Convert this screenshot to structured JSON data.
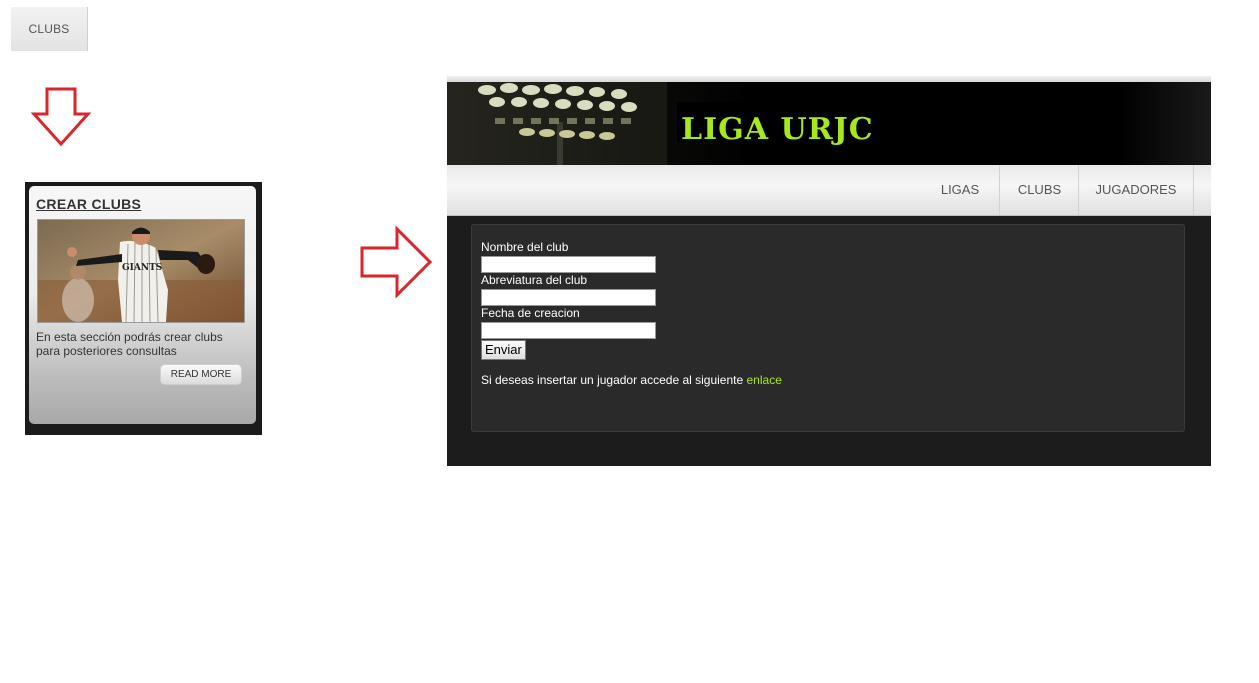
{
  "top_tab": {
    "label": "CLUBS"
  },
  "card": {
    "title": "CREAR CLUBS",
    "description": "En esta sección podrás crear clubs para posteriores consultas",
    "read_more": "READ MORE",
    "photo_jersey_text": "GIANTS"
  },
  "site": {
    "banner_title": "LIGA URJC",
    "nav": [
      "LIGAS",
      "CLUBS",
      "JUGADORES"
    ],
    "form": {
      "field1_label": "Nombre del club",
      "field2_label": "Abreviatura del club",
      "field3_label": "Fecha de creacion",
      "field1_value": "",
      "field2_value": "",
      "field3_value": "",
      "submit": "Enviar"
    },
    "info_text": "Si deseas insertar un jugador accede al siguiente ",
    "info_link": "enlace"
  },
  "colors": {
    "accent_green": "#a6e81c",
    "arrow_red": "#d9252b"
  },
  "icons": [
    "arrow-down-icon",
    "arrow-right-icon"
  ]
}
